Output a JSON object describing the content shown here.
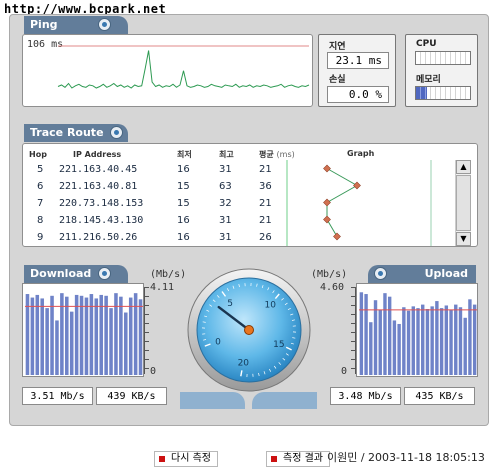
{
  "watermark": "http://www.bcpark.net",
  "ping": {
    "title": "Ping",
    "value_label": "106 ms",
    "series": [
      14,
      16,
      13,
      18,
      12,
      15,
      17,
      14,
      13,
      16,
      15,
      12,
      14,
      17,
      13,
      15,
      18,
      14,
      16,
      13,
      15,
      12,
      16,
      14,
      15,
      38,
      62,
      20,
      14,
      16,
      13,
      15,
      14,
      17,
      13,
      16,
      35,
      15,
      13,
      14,
      16,
      15,
      13,
      14,
      17,
      15,
      14,
      13,
      16,
      15,
      14,
      17,
      13,
      15,
      14,
      16,
      13,
      15,
      14,
      16,
      15,
      13,
      14,
      15,
      17,
      13,
      15,
      16,
      14,
      13,
      15,
      14,
      16
    ],
    "latency_label": "지연",
    "latency_value": "23.1 ms",
    "loss_label": "손실",
    "loss_value": "0.0 %",
    "cpu_label": "CPU",
    "mem_label": "메모리",
    "cpu_level": 0.0,
    "mem_level": 0.2
  },
  "trace": {
    "title": "Trace Route",
    "headers": {
      "hop": "Hop",
      "ip": "IP Address",
      "min": "최저",
      "max": "최고",
      "avg": "평균",
      "unit": "(ms)",
      "graph": "Graph"
    },
    "rows": [
      {
        "hop": "5",
        "ip": "221.163.40.45",
        "min": "16",
        "max": "31",
        "avg": "21"
      },
      {
        "hop": "6",
        "ip": "221.163.40.81",
        "min": "15",
        "max": "63",
        "avg": "36"
      },
      {
        "hop": "7",
        "ip": "220.73.148.153",
        "min": "15",
        "max": "32",
        "avg": "21"
      },
      {
        "hop": "8",
        "ip": "218.145.43.130",
        "min": "16",
        "max": "31",
        "avg": "21"
      },
      {
        "hop": "9",
        "ip": "211.216.50.26",
        "min": "16",
        "max": "31",
        "avg": "26"
      }
    ]
  },
  "download": {
    "title": "Download",
    "unit": "(Mb/s)",
    "max_label": "4.11",
    "zero_label": "0",
    "bars": [
      0.92,
      0.88,
      0.91,
      0.87,
      0.76,
      0.9,
      0.62,
      0.93,
      0.89,
      0.72,
      0.91,
      0.9,
      0.88,
      0.92,
      0.87,
      0.91,
      0.9,
      0.76,
      0.93,
      0.89,
      0.71,
      0.88,
      0.93,
      0.86
    ],
    "avg_level": 0.78,
    "speed_mbps": "3.51 Mb/s",
    "speed_kbs": "439 KB/s"
  },
  "upload": {
    "title": "Upload",
    "unit": "(Mb/s)",
    "max_label": "4.60",
    "zero_label": "0",
    "bars": [
      0.94,
      0.92,
      0.6,
      0.85,
      0.74,
      0.93,
      0.89,
      0.62,
      0.58,
      0.77,
      0.73,
      0.78,
      0.76,
      0.8,
      0.75,
      0.78,
      0.84,
      0.76,
      0.79,
      0.74,
      0.8,
      0.77,
      0.65,
      0.86,
      0.8
    ],
    "avg_level": 0.74,
    "speed_mbps": "3.48 Mb/s",
    "speed_kbs": "435 KB/s"
  },
  "gauge": {
    "ticks": [
      "0",
      "5",
      "10",
      "15",
      "20"
    ],
    "needle_value": 3.8
  },
  "footer": {
    "retest": "다시 측정",
    "result": "측정 결과",
    "credit": "이원민 / 2003-11-18 18:05:13"
  },
  "colors": {
    "tab": "#627d9a",
    "bar": "#6f83c8",
    "avg_line": "#e05050",
    "ping_line": "#2d9a52",
    "gauge_face": "#3aa0d8"
  }
}
